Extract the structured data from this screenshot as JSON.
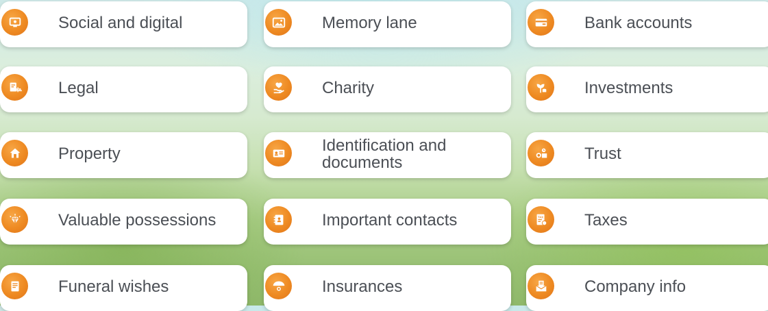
{
  "colors": {
    "icon_orange": "#ee8a22",
    "label_text": "#4b4f55",
    "card_bg": "#ffffff"
  },
  "categories": [
    {
      "label": "Social and digital",
      "icon": "social-digital-icon"
    },
    {
      "label": "Memory lane",
      "icon": "picture-icon"
    },
    {
      "label": "Bank accounts",
      "icon": "bank-card-icon"
    },
    {
      "label": "Legal",
      "icon": "legal-scales-icon"
    },
    {
      "label": "Charity",
      "icon": "charity-hand-icon"
    },
    {
      "label": "Investments",
      "icon": "investment-plant-icon"
    },
    {
      "label": "Property",
      "icon": "house-icon"
    },
    {
      "label": "Identification and documents",
      "icon": "id-card-icon"
    },
    {
      "label": "Trust",
      "icon": "trust-coins-icon"
    },
    {
      "label": "Valuable possessions",
      "icon": "diamond-icon"
    },
    {
      "label": "Important contacts",
      "icon": "address-book-icon"
    },
    {
      "label": "Taxes",
      "icon": "tax-document-icon"
    },
    {
      "label": "Funeral wishes",
      "icon": "funeral-document-icon"
    },
    {
      "label": "Insurances",
      "icon": "umbrella-icon"
    },
    {
      "label": "Company info",
      "icon": "company-envelope-icon"
    }
  ]
}
